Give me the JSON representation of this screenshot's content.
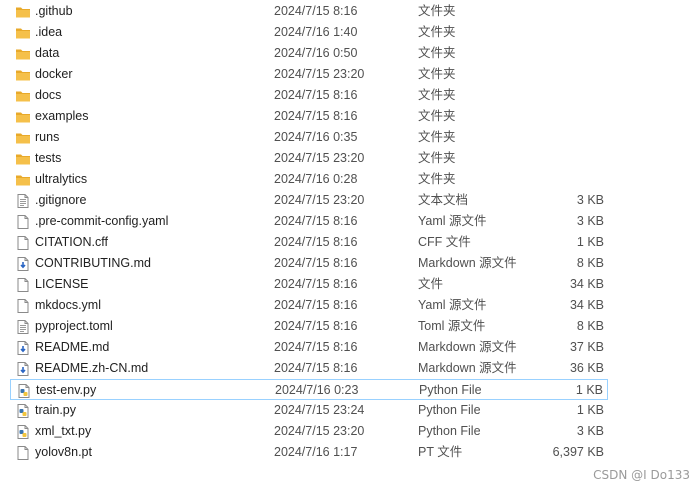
{
  "files": [
    {
      "name": ".github",
      "date": "2024/7/15 8:16",
      "type": "文件夹",
      "size": "",
      "icon": "folder-icon"
    },
    {
      "name": ".idea",
      "date": "2024/7/16 1:40",
      "type": "文件夹",
      "size": "",
      "icon": "folder-icon"
    },
    {
      "name": "data",
      "date": "2024/7/16 0:50",
      "type": "文件夹",
      "size": "",
      "icon": "folder-icon"
    },
    {
      "name": "docker",
      "date": "2024/7/15 23:20",
      "type": "文件夹",
      "size": "",
      "icon": "folder-icon"
    },
    {
      "name": "docs",
      "date": "2024/7/15 8:16",
      "type": "文件夹",
      "size": "",
      "icon": "folder-icon"
    },
    {
      "name": "examples",
      "date": "2024/7/15 8:16",
      "type": "文件夹",
      "size": "",
      "icon": "folder-icon"
    },
    {
      "name": "runs",
      "date": "2024/7/16 0:35",
      "type": "文件夹",
      "size": "",
      "icon": "folder-icon"
    },
    {
      "name": "tests",
      "date": "2024/7/15 23:20",
      "type": "文件夹",
      "size": "",
      "icon": "folder-icon"
    },
    {
      "name": "ultralytics",
      "date": "2024/7/16 0:28",
      "type": "文件夹",
      "size": "",
      "icon": "folder-icon"
    },
    {
      "name": ".gitignore",
      "date": "2024/7/15 23:20",
      "type": "文本文档",
      "size": "3 KB",
      "icon": "text-file-icon"
    },
    {
      "name": ".pre-commit-config.yaml",
      "date": "2024/7/15 8:16",
      "type": "Yaml 源文件",
      "size": "3 KB",
      "icon": "blank-file-icon"
    },
    {
      "name": "CITATION.cff",
      "date": "2024/7/15 8:16",
      "type": "CFF 文件",
      "size": "1 KB",
      "icon": "blank-file-icon"
    },
    {
      "name": "CONTRIBUTING.md",
      "date": "2024/7/15 8:16",
      "type": "Markdown 源文件",
      "size": "8 KB",
      "icon": "markdown-file-icon"
    },
    {
      "name": "LICENSE",
      "date": "2024/7/15 8:16",
      "type": "文件",
      "size": "34 KB",
      "icon": "blank-file-icon"
    },
    {
      "name": "mkdocs.yml",
      "date": "2024/7/15 8:16",
      "type": "Yaml 源文件",
      "size": "34 KB",
      "icon": "blank-file-icon"
    },
    {
      "name": "pyproject.toml",
      "date": "2024/7/15 8:16",
      "type": "Toml 源文件",
      "size": "8 KB",
      "icon": "text-file-icon"
    },
    {
      "name": "README.md",
      "date": "2024/7/15 8:16",
      "type": "Markdown 源文件",
      "size": "37 KB",
      "icon": "markdown-file-icon"
    },
    {
      "name": "README.zh-CN.md",
      "date": "2024/7/15 8:16",
      "type": "Markdown 源文件",
      "size": "36 KB",
      "icon": "markdown-file-icon"
    },
    {
      "name": "test-env.py",
      "date": "2024/7/16 0:23",
      "type": "Python File",
      "size": "1 KB",
      "icon": "python-file-icon",
      "selected": true
    },
    {
      "name": "train.py",
      "date": "2024/7/15 23:24",
      "type": "Python File",
      "size": "1 KB",
      "icon": "python-file-icon"
    },
    {
      "name": "xml_txt.py",
      "date": "2024/7/15 23:20",
      "type": "Python File",
      "size": "3 KB",
      "icon": "python-file-icon"
    },
    {
      "name": "yolov8n.pt",
      "date": "2024/7/16 1:17",
      "type": "PT 文件",
      "size": "6,397 KB",
      "icon": "blank-file-icon"
    }
  ],
  "watermark": "CSDN @I Do133",
  "colors": {
    "folder": "#f5c04a",
    "selection_border": "#99d1ff",
    "md_blue": "#2b66c4",
    "py_blue": "#3a75b0",
    "py_yellow": "#f2c53d"
  }
}
